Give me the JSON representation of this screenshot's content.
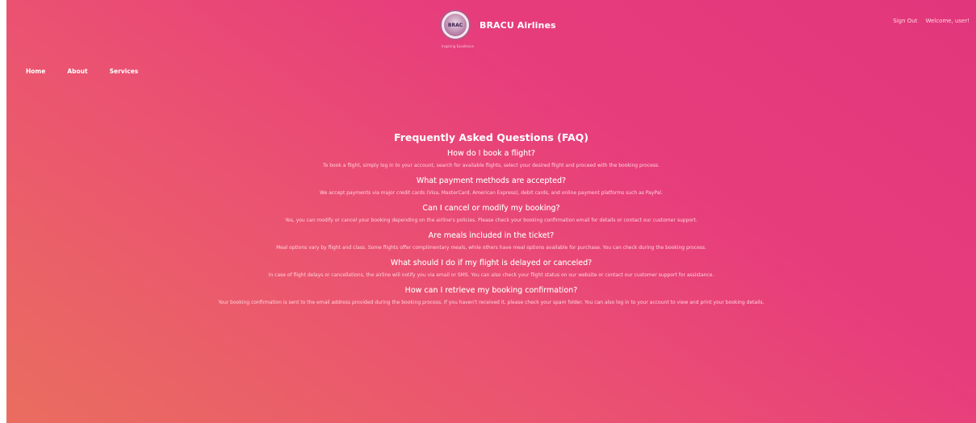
{
  "header": {
    "logo_text": "BRAC",
    "logo_caption": "Inspiring Excellence",
    "brand_name": "BRACU Airlines",
    "sign_out": "Sign Out",
    "welcome": "Welcome, user!"
  },
  "nav": {
    "items": [
      {
        "label": "Home"
      },
      {
        "label": "About"
      },
      {
        "label": "Services"
      }
    ]
  },
  "faq": {
    "title": "Frequently Asked Questions (FAQ)",
    "items": [
      {
        "question": "How do I book a flight?",
        "answer": "To book a flight, simply log in to your account, search for available flights, select your desired flight and proceed with the booking process."
      },
      {
        "question": "What payment methods are accepted?",
        "answer": "We accept payments via major credit cards (Visa, MasterCard, American Express), debit cards, and online payment platforms such as PayPal."
      },
      {
        "question": "Can I cancel or modify my booking?",
        "answer": "Yes, you can modify or cancel your booking depending on the airline's policies. Please check your booking confirmation email for details or contact our customer support."
      },
      {
        "question": "Are meals included in the ticket?",
        "answer": "Meal options vary by flight and class. Some flights offer complimentary meals, while others have meal options available for purchase. You can check during the booking process."
      },
      {
        "question": "What should I do if my flight is delayed or canceled?",
        "answer": "In case of flight delays or cancellations, the airline will notify you via email or SMS. You can also check your flight status on our website or contact our customer support for assistance."
      },
      {
        "question": "How can I retrieve my booking confirmation?",
        "answer": "Your booking confirmation is sent to the email address provided during the booking process. If you haven't received it, please check your spam folder. You can also log in to your account to view and print your booking details."
      }
    ]
  },
  "colors": {
    "gradient_start": "#ea6d5f",
    "gradient_end": "#e2367c",
    "text": "#ffffff"
  }
}
